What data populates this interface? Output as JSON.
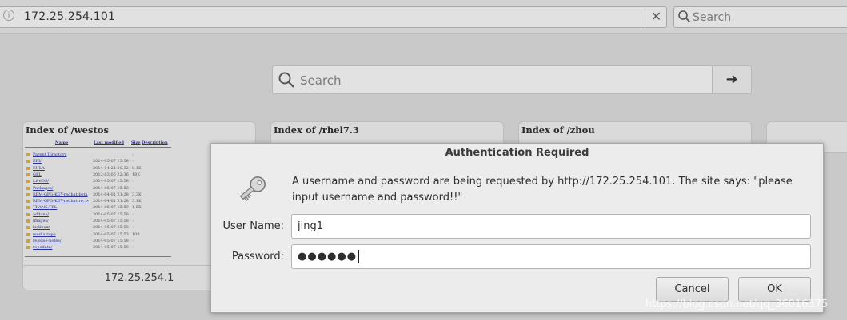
{
  "browser": {
    "info_icon": "info-icon",
    "url": "172.25.254.101",
    "clear_glyph": "✕",
    "search_placeholder": "Search"
  },
  "newtab": {
    "search_placeholder": "Search",
    "go_glyph": "➜",
    "tiles": [
      {
        "title": "Index of /westos",
        "caption": "172.25.254.1",
        "listing": {
          "headers": [
            "Name",
            "Last modified",
            "Size",
            "Description"
          ],
          "rows": [
            {
              "name": "Parent Directory",
              "date": "",
              "size": "-"
            },
            {
              "name": "EFI/",
              "date": "2014-05-07 15:58",
              "size": "-"
            },
            {
              "name": "EULA",
              "date": "2014-04-24 20:32",
              "size": "8.1K"
            },
            {
              "name": "GPL",
              "date": "2012-03-06 22:36",
              "size": "18K"
            },
            {
              "name": "LiveOS/",
              "date": "2014-05-07 15:58",
              "size": "-"
            },
            {
              "name": "Packages/",
              "date": "2014-05-07 15:58",
              "size": "-"
            },
            {
              "name": "RPM-GPG-KEY-redhat-beta",
              "date": "2014-04-01 21:28",
              "size": "3.3K"
            },
            {
              "name": "RPM-GPG-KEY-redhat-re..>",
              "date": "2014-04-01 21:28",
              "size": "3.1K"
            },
            {
              "name": "TRANS.TBL",
              "date": "2014-05-07 15:59",
              "size": "1.5K"
            },
            {
              "name": "addons/",
              "date": "2014-05-07 15:58",
              "size": "-"
            },
            {
              "name": "images/",
              "date": "2014-05-07 15:58",
              "size": "-"
            },
            {
              "name": "isolinux/",
              "date": "2014-05-07 15:58",
              "size": "-"
            },
            {
              "name": "media.repo",
              "date": "2014-05-07 15:53",
              "size": "109"
            },
            {
              "name": "release-notes/",
              "date": "2014-05-07 15:58",
              "size": "-"
            },
            {
              "name": "repodata/",
              "date": "2014-05-07 15:58",
              "size": "-"
            }
          ]
        }
      },
      {
        "title": "Index of /rhel7.3"
      },
      {
        "title": "Index of /zhou"
      }
    ]
  },
  "dialog": {
    "title": "Authentication Required",
    "icon": "key-icon",
    "message": "A username and password are being requested by http://172.25.254.101. The site says: \"please input username and password!!\"",
    "username_label": "User Name:",
    "username_value": "jing1",
    "password_label": "Password:",
    "password_mask": "●●●●●●",
    "cancel_label": "Cancel",
    "ok_label": "OK"
  },
  "watermark": "https://blog.csdn.net/qq_36016375",
  "colors": {
    "background": "#c9c9c9",
    "dialog": "#ececec",
    "link": "#28319b"
  }
}
